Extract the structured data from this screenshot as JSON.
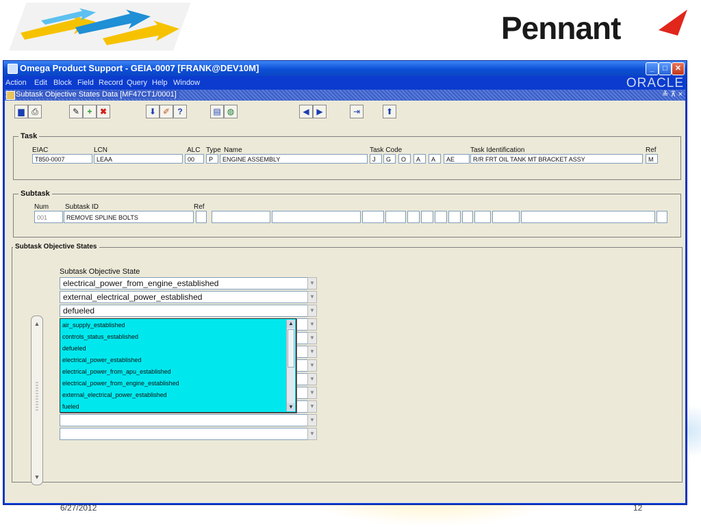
{
  "brand": "Pennant",
  "window": {
    "title": "Omega Product Support - GEIA-0007 [FRANK@DEV10M]",
    "controls": [
      "minimize",
      "maximize",
      "close"
    ]
  },
  "menu": [
    "Action",
    "Edit",
    "Block",
    "Field",
    "Record",
    "Query",
    "Help",
    "Window"
  ],
  "vendor": "ORACLE",
  "form": {
    "title": "Subtask Objective States Data  [MF47CT1/0001]",
    "controls": "≚ ⊼ ×"
  },
  "toolbar": [
    "save-icon",
    "print-icon",
    "edit-icon",
    "add-icon",
    "delete-icon",
    "download-icon",
    "pencil-icon",
    "help-icon",
    "form-icon",
    "globe-icon",
    "prev-icon",
    "next-icon",
    "exit-icon",
    "up-icon"
  ],
  "task": {
    "group_title": "Task",
    "labels": {
      "eiac": "EIAC",
      "lcn": "LCN",
      "alc": "ALC",
      "type": "Type",
      "name": "Name",
      "task_code": "Task Code",
      "task_identification": "Task Identification",
      "ref": "Ref"
    },
    "values": {
      "eiac": "T850-0007",
      "lcn": "LEAA",
      "alc": "00",
      "type": "P",
      "name": "ENGINE ASSEMBLY",
      "task_code": [
        "J",
        "G",
        "O",
        "A",
        "A",
        "AE"
      ],
      "task_identification": "R/R FRT OIL TANK MT BRACKET ASSY",
      "ref": "M"
    }
  },
  "subtask": {
    "group_title": "Subtask",
    "labels": {
      "num": "Num",
      "subtask_id": "Subtask ID",
      "ref": "Ref"
    },
    "values": {
      "num": "001",
      "subtask_id": "REMOVE SPLINE BOLTS"
    }
  },
  "objectives": {
    "group_title": "Subtask Objective States",
    "column_label": "Subtask Objective State",
    "rows": [
      "electrical_power_from_engine_established",
      "external_electrical_power_established",
      "defueled",
      "",
      "",
      "",
      "",
      "",
      "",
      ""
    ],
    "lov_options": [
      "air_supply_established",
      "controls_status_established",
      "defueled",
      "electrical_power_established",
      "electrical_power_from_apu_established",
      "electrical_power_from_engine_established",
      "external_electrical_power_established",
      "fueled"
    ]
  },
  "footer": {
    "date": "6/27/2012",
    "page": "12"
  }
}
